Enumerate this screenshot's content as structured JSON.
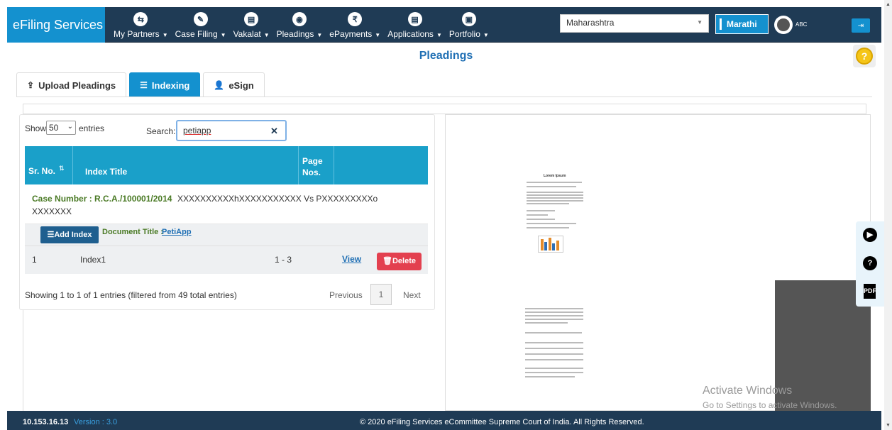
{
  "brand": "eFiling Services",
  "nav": [
    {
      "label": "My Partners",
      "icon": "partners-icon",
      "glyph": "⇆"
    },
    {
      "label": "Case Filing",
      "icon": "pencil-icon",
      "glyph": "✎"
    },
    {
      "label": "Vakalat",
      "icon": "document-icon",
      "glyph": "▤"
    },
    {
      "label": "Pleadings",
      "icon": "pleadings-icon",
      "glyph": "◉"
    },
    {
      "label": "ePayments",
      "icon": "rupee-icon",
      "glyph": "₹"
    },
    {
      "label": "Applications",
      "icon": "file-icon",
      "glyph": "▤"
    },
    {
      "label": "Portfolio",
      "icon": "briefcase-icon",
      "glyph": "▣"
    }
  ],
  "state": "Maharashtra",
  "language_button": "Marathi",
  "toggle_label": "ABC",
  "page_title": "Pleadings",
  "tabs": {
    "upload": "Upload Pleadings",
    "indexing": "Indexing",
    "esign": "eSign"
  },
  "table_controls": {
    "show": "Show",
    "page_size": "50",
    "entries": "entries",
    "search_label": "Search:",
    "search_value": "petiapp"
  },
  "table": {
    "headers": {
      "sr": "Sr. No.",
      "title": "Index Title",
      "page": "Page Nos."
    },
    "case_label": "Case Number : R.C.A./100001/2014",
    "case_parties": "XXXXXXXXXXhXXXXXXXXXXX Vs PXXXXXXXXXo",
    "case_parties_2": "XXXXXXX",
    "add_index": "Add Index",
    "doc_title_label": "Document Title :",
    "doc_title_value": "PetiApp",
    "rows": [
      {
        "sr": "1",
        "title": "Index1",
        "pages": "1 - 3",
        "view": "View",
        "delete": "Delete"
      }
    ],
    "info": "Showing 1 to 1 of 1 entries (filtered from 49 total entries)",
    "previous": "Previous",
    "page": "1",
    "next": "Next"
  },
  "preview": {
    "doc_heading": "Lorem Ipsum"
  },
  "watermark": {
    "line1": "Activate Windows",
    "line2": "Go to Settings to activate Windows."
  },
  "footer": {
    "ip": "10.153.16.13",
    "version": "Version : 3.0",
    "copyright": "© 2020 eFiling Services eCommittee Supreme Court of India. All Rights Reserved."
  }
}
